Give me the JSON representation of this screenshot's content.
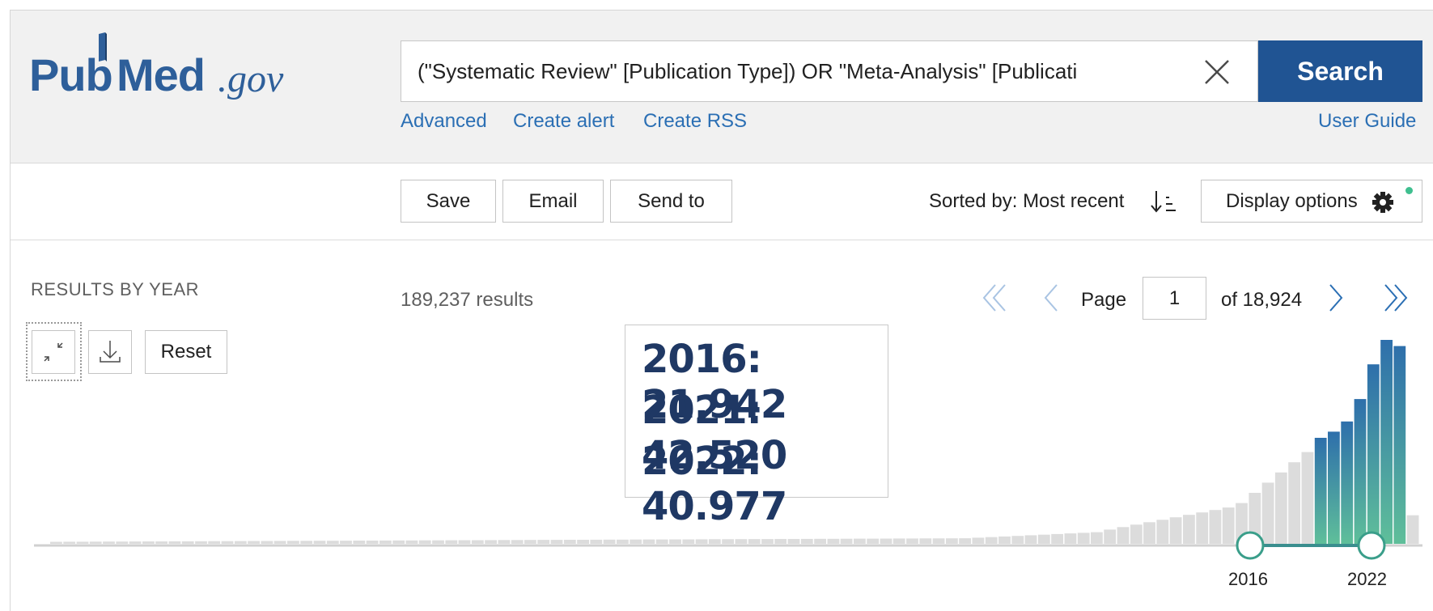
{
  "logo": {
    "pub": "Pub",
    "med": "Med",
    "gov": ".gov"
  },
  "search": {
    "query": "(\"Systematic Review\" [Publication Type]) OR \"Meta-Analysis\" [Publicati",
    "button_label": "Search"
  },
  "links": {
    "advanced": "Advanced",
    "create_alert": "Create alert",
    "create_rss": "Create RSS",
    "user_guide": "User Guide"
  },
  "toolbar": {
    "save": "Save",
    "email": "Email",
    "send_to": "Send to",
    "sorted_by": "Sorted by: Most recent",
    "display_options": "Display options"
  },
  "sidebar": {
    "results_by_year": "RESULTS BY YEAR",
    "reset": "Reset"
  },
  "results": {
    "count_text": "189,237 results"
  },
  "pagination": {
    "page_label": "Page",
    "current_page": "1",
    "of_label": "of 18,924"
  },
  "annotation": {
    "line1": "2016: 21.942",
    "line2": "2021: 42.520",
    "line3": "2022: 40.977"
  },
  "colors": {
    "brand": "#205493",
    "link": "#2b6fb4",
    "bar_selected_top": "#2e6fab",
    "bar_selected_bottom": "#5fbf9a",
    "bar_unselected": "#dcdcdc",
    "annotation_text": "#1f3864",
    "status_dot": "#3fbf8f"
  },
  "chart_data": {
    "type": "bar",
    "x": [
      "1920",
      "1921",
      "1922",
      "1923",
      "1924",
      "1925",
      "1926",
      "1927",
      "1928",
      "1929",
      "1930",
      "1931",
      "1932",
      "1933",
      "1934",
      "1935",
      "1936",
      "1937",
      "1938",
      "1939",
      "1940",
      "1941",
      "1942",
      "1943",
      "1944",
      "1945",
      "1946",
      "1947",
      "1948",
      "1949",
      "1950",
      "1951",
      "1952",
      "1953",
      "1954",
      "1955",
      "1956",
      "1957",
      "1958",
      "1959",
      "1960",
      "1961",
      "1962",
      "1963",
      "1964",
      "1965",
      "1966",
      "1967",
      "1968",
      "1969",
      "1970",
      "1971",
      "1972",
      "1973",
      "1974",
      "1975",
      "1976",
      "1977",
      "1978",
      "1979",
      "1980",
      "1981",
      "1982",
      "1983",
      "1984",
      "1985",
      "1986",
      "1987",
      "1988",
      "1989",
      "1990",
      "1991",
      "1992",
      "1993",
      "1994",
      "1995",
      "1996",
      "1997",
      "1998",
      "1999",
      "2000",
      "2001",
      "2002",
      "2003",
      "2004",
      "2005",
      "2006",
      "2007",
      "2008",
      "2009",
      "2010",
      "2011",
      "2012",
      "2013",
      "2014",
      "2015",
      "2016",
      "2017",
      "2018",
      "2019",
      "2020",
      "2021",
      "2022",
      "2023"
    ],
    "values": [],
    "selected_range": [
      "2016",
      "2022"
    ],
    "tick_labels": [
      "2016",
      "2022"
    ]
  }
}
